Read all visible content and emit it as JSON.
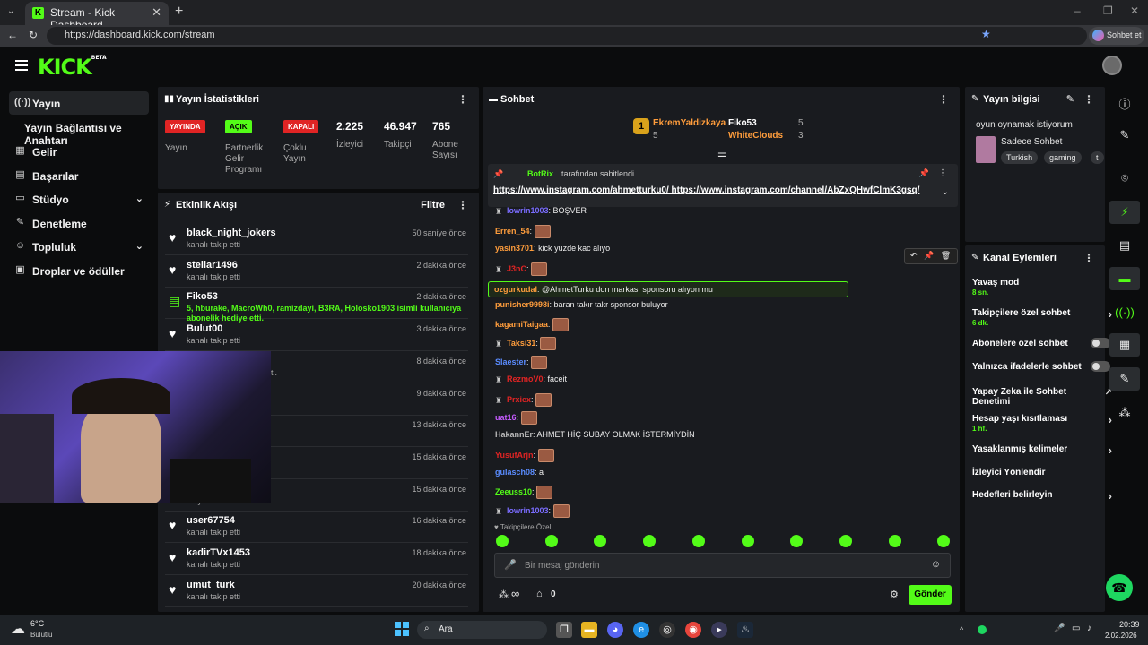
{
  "browser": {
    "tab_title": "Stream - Kick Dashboard",
    "url": "https://dashboard.kick.com/stream",
    "profile_button": "Sohbet et"
  },
  "brand": {
    "logo": "KICK",
    "logo_tag": "BETA",
    "accent": "#53fc18"
  },
  "sidebar": {
    "items": [
      {
        "label": "Yayın",
        "icon": "broadcast-icon"
      },
      {
        "label": "Yayın Bağlantısı ve Anahtarı",
        "icon": ""
      },
      {
        "label": "Gelir",
        "icon": "revenue-icon"
      },
      {
        "label": "Başarılar",
        "icon": "achievements-icon"
      },
      {
        "label": "Stüdyo",
        "icon": "studio-icon"
      },
      {
        "label": "Denetleme",
        "icon": "moderation-icon"
      },
      {
        "label": "Topluluk",
        "icon": "community-icon"
      },
      {
        "label": "Droplar ve ödüller",
        "icon": "drops-icon"
      }
    ]
  },
  "stats": {
    "title": "Yayın İstatistikleri",
    "badges": [
      {
        "badge": "YAYINDA",
        "label": "Yayın",
        "color": "#e02424"
      },
      {
        "badge": "AÇIK",
        "label": "Partnerlik Gelir Programı",
        "color": "#53fc18"
      },
      {
        "badge": "KAPALI",
        "label": "Çoklu Yayın",
        "color": "#e02424"
      }
    ],
    "numbers": [
      {
        "value": "2.225",
        "label": "İzleyici"
      },
      {
        "value": "46.947",
        "label": "Takipçi"
      },
      {
        "value": "765",
        "label": "Abone Sayısı"
      }
    ]
  },
  "activity": {
    "title": "Etkinlik Akışı",
    "filter": "Filtre",
    "items": [
      {
        "name": "black_night_jokers",
        "sub": "kanalı takip etti",
        "time": "50 saniye önce"
      },
      {
        "name": "stellar1496",
        "sub": "kanalı takip etti",
        "time": "2 dakika önce"
      },
      {
        "name": "Fiko53",
        "sub": "5, hburake, MacroWh0, ramizdayi, B3RA, Holosko1903 isimli kullanıcıya abonelik hediye etti.",
        "time": "2 dakika önce"
      },
      {
        "name": "Bulut00",
        "sub": "kanalı takip etti",
        "time": "3 dakika önce"
      },
      {
        "name": "",
        "sub": "ıcıya abonelik hediye etti.",
        "time": "8 dakika önce"
      },
      {
        "name": "",
        "sub": "a abonelik hediye etti.",
        "time": "9 dakika önce"
      },
      {
        "name": "",
        "sub": "",
        "time": "13 dakika önce"
      },
      {
        "name": "e oldu!",
        "sub": "",
        "time": "15 dakika önce"
      },
      {
        "name": "e oldu!",
        "sub": "1 aylık abone oldular",
        "time": "15 dakika önce"
      },
      {
        "name": "user67754",
        "sub": "kanalı takip etti",
        "time": "16 dakika önce"
      },
      {
        "name": "kadirTVx1453",
        "sub": "kanalı takip etti",
        "time": "18 dakika önce"
      },
      {
        "name": "umut_turk",
        "sub": "kanalı takip etti",
        "time": "20 dakika önce"
      }
    ]
  },
  "chat": {
    "title": "Sohbet",
    "leaders": [
      {
        "name": "EkremYaldizkaya",
        "count": "5"
      },
      {
        "name": "Fiko53",
        "count": "5"
      },
      {
        "name": "WhiteClouds",
        "count": "3"
      }
    ],
    "pinned": {
      "by": "BotRix",
      "by_suffix": "tarafından sabitlendi",
      "text": "https://www.instagram.com/ahmetturku0/ https://www.instagram.com/channel/AbZxQHwfClmK3gsq/"
    },
    "messages": [
      {
        "user": "lowrin1003",
        "text": "BOŞVER",
        "color": "#7a6cff"
      },
      {
        "user": "Erren_54",
        "text": "",
        "color": "#ff9d3c",
        "emote": true
      },
      {
        "user": "yasin3701",
        "text": "kick yuzde kac alıyo",
        "color": "#ff9d3c"
      },
      {
        "user": "J3nC",
        "text": "",
        "color": "#e02424",
        "emote": true
      },
      {
        "user": "ozgurkudal",
        "text": "@AhmetTurku don markası sponsoru alıyon mu",
        "color": "#ff9d3c"
      },
      {
        "user": "punisher9998i",
        "text": "baran takır takr sponsor buluyor",
        "color": "#ff9d3c"
      },
      {
        "user": "kagamiTaigaa",
        "text": "",
        "color": "#ff9d3c",
        "emote": true
      },
      {
        "user": "Taksi31",
        "text": "",
        "color": "#ff9d3c",
        "emote": true
      },
      {
        "user": "Slaester",
        "text": "",
        "color": "#5a8cff",
        "emote": true
      },
      {
        "user": "RezmoV0",
        "text": "faceit",
        "color": "#e02424"
      },
      {
        "user": "Prxiex",
        "text": "",
        "color": "#e02424",
        "emote": true
      },
      {
        "user": "uat16",
        "text": "",
        "color": "#c65cff",
        "emote": true
      },
      {
        "user": "HakannEr",
        "text": "AHMET HİÇ SUBAY OLMAK İSTERMİYDİN",
        "color": "#bbbbbb"
      },
      {
        "user": "YusufArjn",
        "text": "",
        "color": "#e02424",
        "emote": true
      },
      {
        "user": "gulasch08",
        "text": "a",
        "color": "#5a8cff"
      },
      {
        "user": "Zeeuss10",
        "text": "",
        "color": "#53fc18",
        "emote": true
      },
      {
        "user": "lowrin1003",
        "text": "",
        "color": "#7a6cff",
        "emote": true
      }
    ],
    "followers_only": "Takipçilere Özel",
    "input_placeholder": "Bir mesaj gönderin",
    "infinite": "∞",
    "gifts": "0",
    "send": "Gönder"
  },
  "info": {
    "title": "Yayın bilgisi",
    "stream_title": "oyun oynamak istiyorum",
    "category": "Sadece Sohbet",
    "tags": [
      "Turkish",
      "gaming",
      "t"
    ]
  },
  "actions": {
    "title": "Kanal Eylemleri",
    "items": [
      {
        "label": "Yavaş mod",
        "sub": "8 sn.",
        "control": "arrow"
      },
      {
        "label": "Takipçilere özel sohbet",
        "sub": "6 dk.",
        "control": "arrow"
      },
      {
        "label": "Abonelere özel sohbet",
        "sub": "",
        "control": "toggle"
      },
      {
        "label": "Yalnızca ifadelerle sohbet",
        "sub": "",
        "control": "toggle"
      },
      {
        "label": "Yapay Zeka ile Sohbet Denetimi",
        "sub": "",
        "control": "external"
      },
      {
        "label": "Hesap yaşı kısıtlaması",
        "sub": "1 hf.",
        "control": "arrow"
      },
      {
        "label": "Yasaklanmış kelimeler",
        "sub": "",
        "control": "arrow"
      },
      {
        "label": "İzleyici Yönlendir",
        "sub": "",
        "control": "none"
      },
      {
        "label": "Hedefleri belirleyin",
        "sub": "",
        "control": "arrow"
      }
    ]
  },
  "taskbar": {
    "weather_temp": "6°C",
    "weather_desc": "Bulutlu",
    "search": "Ara",
    "time": "20:39",
    "date": "2.02.2026"
  }
}
